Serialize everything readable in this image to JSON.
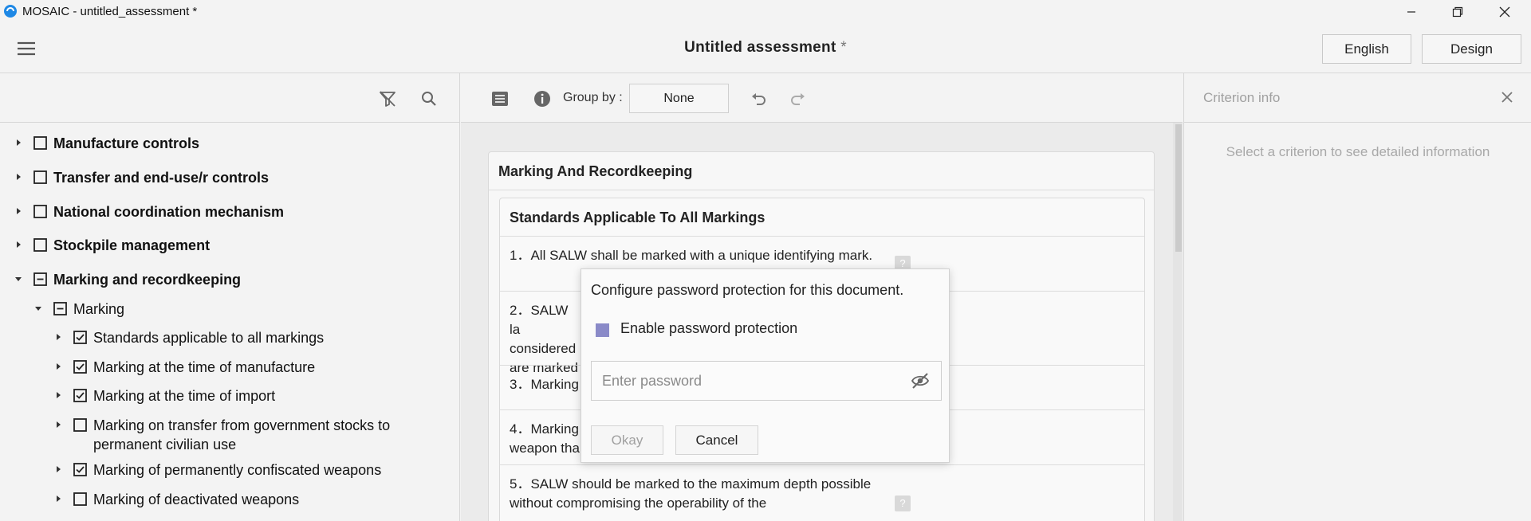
{
  "window": {
    "title": "MOSAIC - untitled_assessment *"
  },
  "header": {
    "title": "Untitled assessment",
    "unsaved_marker": "*",
    "language_button": "English",
    "design_button": "Design"
  },
  "left_panel": {
    "tree": [
      {
        "label": "Manufacture controls",
        "level": 0,
        "checked": false,
        "expanded": false
      },
      {
        "label": "Transfer and end-use/r controls",
        "level": 0,
        "checked": false,
        "expanded": false
      },
      {
        "label": "National coordination mechanism",
        "level": 0,
        "checked": false,
        "expanded": false
      },
      {
        "label": "Stockpile management",
        "level": 0,
        "checked": false,
        "expanded": false
      },
      {
        "label": "Marking and recordkeeping",
        "level": 0,
        "checked": "partial",
        "expanded": true
      },
      {
        "label": "Marking",
        "level": 1,
        "checked": "partial",
        "expanded": true
      },
      {
        "label": "Standards applicable to all markings",
        "level": 2,
        "checked": true,
        "expanded": false
      },
      {
        "label": "Marking at the time of manufacture",
        "level": 2,
        "checked": true,
        "expanded": false
      },
      {
        "label": "Marking at the time of import",
        "level": 2,
        "checked": true,
        "expanded": false
      },
      {
        "label": "Marking on transfer from government stocks to permanent civilian use",
        "level": 2,
        "checked": false,
        "expanded": false
      },
      {
        "label": "Marking of permanently confiscated weapons",
        "level": 2,
        "checked": true,
        "expanded": false
      },
      {
        "label": "Marking of deactivated weapons",
        "level": 2,
        "checked": false,
        "expanded": false
      }
    ]
  },
  "center_panel": {
    "group_by_label": "Group by :",
    "group_by_value": "None",
    "section_title": "Marking And Recordkeeping",
    "subsection_title": "Standards Applicable To All Markings",
    "criteria": [
      {
        "text": "1．All SALW shall be marked with a unique identifying mark."
      },
      {
        "text": "2．SALW la considered are marked"
      },
      {
        "text": "3．Marking"
      },
      {
        "text": "4．Marking weapon tha"
      },
      {
        "text": "5．SALW should be marked to the maximum depth possible without compromising the operability of the"
      }
    ],
    "help_marker": "?"
  },
  "right_panel": {
    "title": "Criterion info",
    "empty_message": "Select a criterion to see detailed information"
  },
  "dialog": {
    "title": "Configure password protection for this document.",
    "checkbox_label": "Enable password protection",
    "password_placeholder": "Enter password",
    "password_value": "",
    "ok_button": "Okay",
    "cancel_button": "Cancel"
  },
  "colors": {
    "checkbox_accent": "#8a8ac8",
    "disabled_text": "#a0a0a0"
  }
}
